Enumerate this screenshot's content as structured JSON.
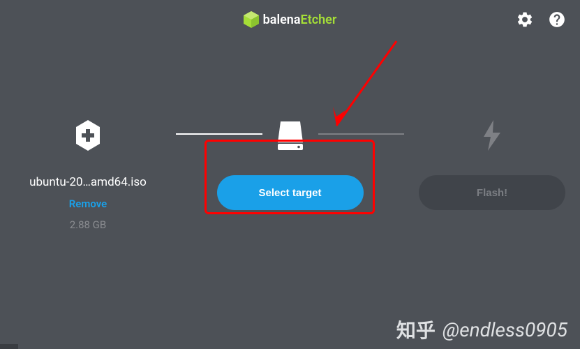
{
  "header": {
    "logo_prefix": "balena",
    "logo_accent": "Etcher"
  },
  "steps": {
    "image": {
      "filename": "ubuntu-20…amd64.iso",
      "remove_label": "Remove",
      "size": "2.88 GB"
    },
    "target": {
      "button_label": "Select target"
    },
    "flash": {
      "button_label": "Flash!"
    }
  },
  "watermark": {
    "text": "@endless0905",
    "source": "知乎"
  }
}
